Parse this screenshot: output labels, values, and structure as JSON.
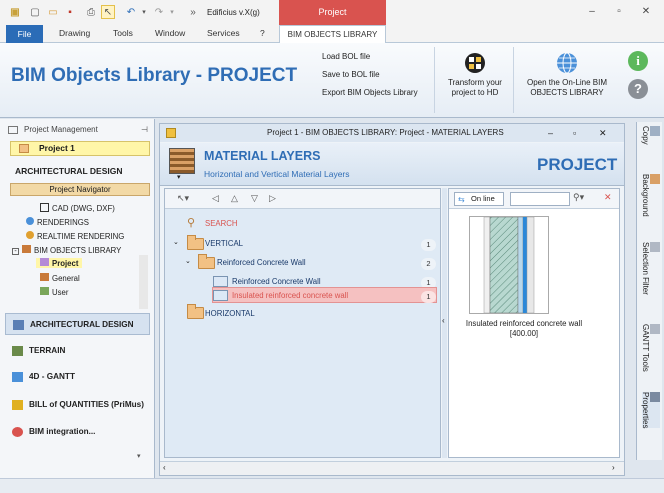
{
  "title_bar": {
    "app_title": "Edificius v.X(g)",
    "context_tab": "Project",
    "window_controls": [
      "minimize",
      "restore",
      "close"
    ]
  },
  "ribbon_tabs": {
    "file": "File",
    "tabs": [
      "Drawing",
      "Tools",
      "Window",
      "Services",
      "?"
    ],
    "active": "BIM OBJECTS LIBRARY"
  },
  "ribbon": {
    "big_title": "BIM Objects Library - PROJECT",
    "links": [
      "Load BOL file",
      "Save to BOL file",
      "Export BIM Objects Library"
    ],
    "transform_label_1": "Transform your",
    "transform_label_2": "project to HD",
    "open_label_1": "Open the On-Line BIM",
    "open_label_2": "OBJECTS LIBRARY"
  },
  "left_panel": {
    "header": "Project Management",
    "project": "Project 1",
    "architectural_design": "ARCHITECTURAL DESIGN",
    "navigator": "Project Navigator",
    "tree": {
      "cad": "CAD (DWG, DXF)",
      "renderings": "RENDERINGS",
      "realtime": "REALTIME RENDERING",
      "bim_lib": "BIM OBJECTS LIBRARY",
      "project": "Project",
      "general": "General",
      "user": "User"
    },
    "nav_buttons": [
      "ARCHITECTURAL DESIGN",
      "TERRAIN",
      "4D - GANTT",
      "BILL of QUANTITIES (PriMus)",
      "BIM integration..."
    ]
  },
  "doc_window": {
    "title": "Project 1 -  BIM OBJECTS LIBRARY: Project - MATERIAL LAYERS",
    "banner_title": "MATERIAL LAYERS",
    "banner_subtitle": "Horizontal and Vertical Material Layers",
    "banner_project": "PROJECT",
    "tree": {
      "search": "SEARCH",
      "vertical": "VERTICAL",
      "vertical_count": "1",
      "rcw_folder": "Reinforced Concrete Wall",
      "rcw_folder_count": "2",
      "rcw_item": "Reinforced Concrete Wall",
      "rcw_item_count": "1",
      "irc_item": "Insulated reinforced concrete wall",
      "irc_item_count": "1",
      "horizontal": "HORIZONTAL"
    },
    "preview": {
      "online_button": "On line",
      "search_placeholder": "",
      "caption_1": "Insulated reinforced concrete wall",
      "caption_2": "[400.00]"
    }
  },
  "dock_tabs": [
    "Copy",
    "Background",
    "Selection Filter",
    "GANTT Tools",
    "Properties"
  ],
  "colors": {
    "accent_blue": "#2f6db5",
    "context_red": "#d9534f",
    "selection_yellow": "#fff6a8",
    "selection_pink": "#f5c1c1"
  }
}
